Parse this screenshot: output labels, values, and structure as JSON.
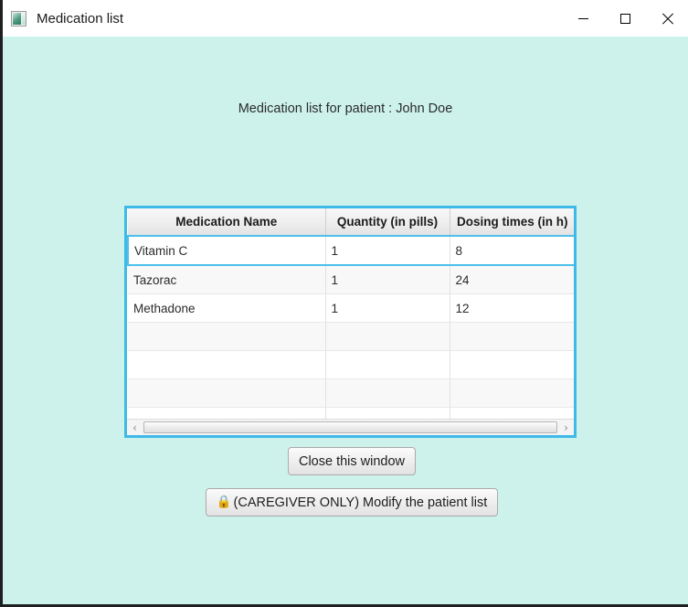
{
  "window": {
    "title": "Medication list",
    "icon": "app-window-icon",
    "background_color": "#cdf2ec",
    "accent_color": "#3fb9e8",
    "controls": {
      "minimize": "minimize-icon",
      "maximize": "maximize-icon",
      "close": "close-icon"
    }
  },
  "content": {
    "patient_label": "Medication list for patient : John Doe"
  },
  "table": {
    "columns": [
      "Medication Name",
      "Quantity (in pills)",
      "Dosing times (in h)"
    ],
    "rows": [
      {
        "name": "Vitamin C",
        "quantity": "1",
        "dosing": "8",
        "selected": true
      },
      {
        "name": "Tazorac",
        "quantity": "1",
        "dosing": "24",
        "selected": false
      },
      {
        "name": "Methadone",
        "quantity": "1",
        "dosing": "12",
        "selected": false
      },
      {
        "name": "",
        "quantity": "",
        "dosing": "",
        "selected": false
      },
      {
        "name": "",
        "quantity": "",
        "dosing": "",
        "selected": false
      },
      {
        "name": "",
        "quantity": "",
        "dosing": "",
        "selected": false
      },
      {
        "name": "",
        "quantity": "",
        "dosing": "",
        "selected": false
      }
    ],
    "scrollbar": {
      "left_arrow": "‹",
      "right_arrow": "›"
    }
  },
  "buttons": {
    "close_window": "Close this window",
    "modify_list": "(CAREGIVER ONLY) Modify the patient list",
    "modify_list_icon": "lock-icon",
    "lock_glyph": "🔒"
  }
}
